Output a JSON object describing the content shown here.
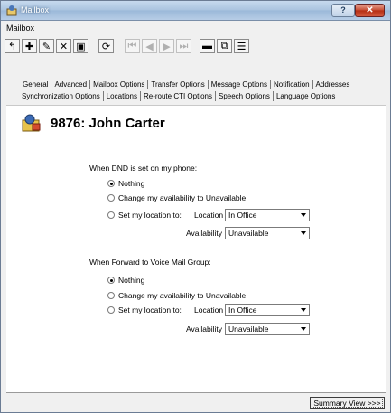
{
  "window": {
    "title": "Mailbox"
  },
  "menubar": {
    "items": [
      "Mailbox"
    ]
  },
  "toolbar": {
    "buttons": [
      {
        "name": "back-icon",
        "glyph": "↰"
      },
      {
        "name": "add-icon",
        "glyph": "✚"
      },
      {
        "name": "edit-icon",
        "glyph": "✎"
      },
      {
        "name": "delete-icon",
        "glyph": "✕"
      },
      {
        "name": "save-icon",
        "glyph": "▣"
      },
      {
        "name": "refresh-icon",
        "glyph": "⟳"
      },
      {
        "name": "first-icon",
        "glyph": "⏮"
      },
      {
        "name": "prev-icon",
        "glyph": "◀"
      },
      {
        "name": "next-icon",
        "glyph": "▶"
      },
      {
        "name": "last-icon",
        "glyph": "⏭"
      },
      {
        "name": "folder-icon",
        "glyph": "▬"
      },
      {
        "name": "copy-icon",
        "glyph": "⧉"
      },
      {
        "name": "list-icon",
        "glyph": "☰"
      }
    ]
  },
  "tabs": {
    "row1": [
      "General",
      "Advanced",
      "Mailbox Options",
      "Transfer Options",
      "Message Options",
      "Notification",
      "Addresses"
    ],
    "row2": [
      "Synchronization Options",
      "Locations",
      "Re-route CTI Options",
      "Speech Options",
      "Language Options"
    ]
  },
  "header": {
    "title": "9876: John Carter"
  },
  "dnd": {
    "heading": "When DND is set on my phone:",
    "option_nothing": "Nothing",
    "option_change": "Change my availability to Unavailable",
    "option_location": "Set my location to:",
    "location_label": "Location",
    "location_value": "In Office",
    "availability_label": "Availability",
    "availability_value": "Unavailable",
    "selected": "nothing"
  },
  "forward": {
    "heading": "When Forward to Voice Mail Group:",
    "option_nothing": "Nothing",
    "option_change": "Change my availability to Unavailable",
    "option_location": "Set my location to:",
    "location_label": "Location",
    "location_value": "In Office",
    "availability_label": "Availability",
    "availability_value": "Unavailable",
    "selected": "nothing"
  },
  "footer": {
    "summary_button": "Summary View >>>"
  },
  "colors": {
    "titlebar": "#a9c3df",
    "close": "#c64a30",
    "panel": "#ffffff",
    "chrome": "#f0f0f0"
  }
}
